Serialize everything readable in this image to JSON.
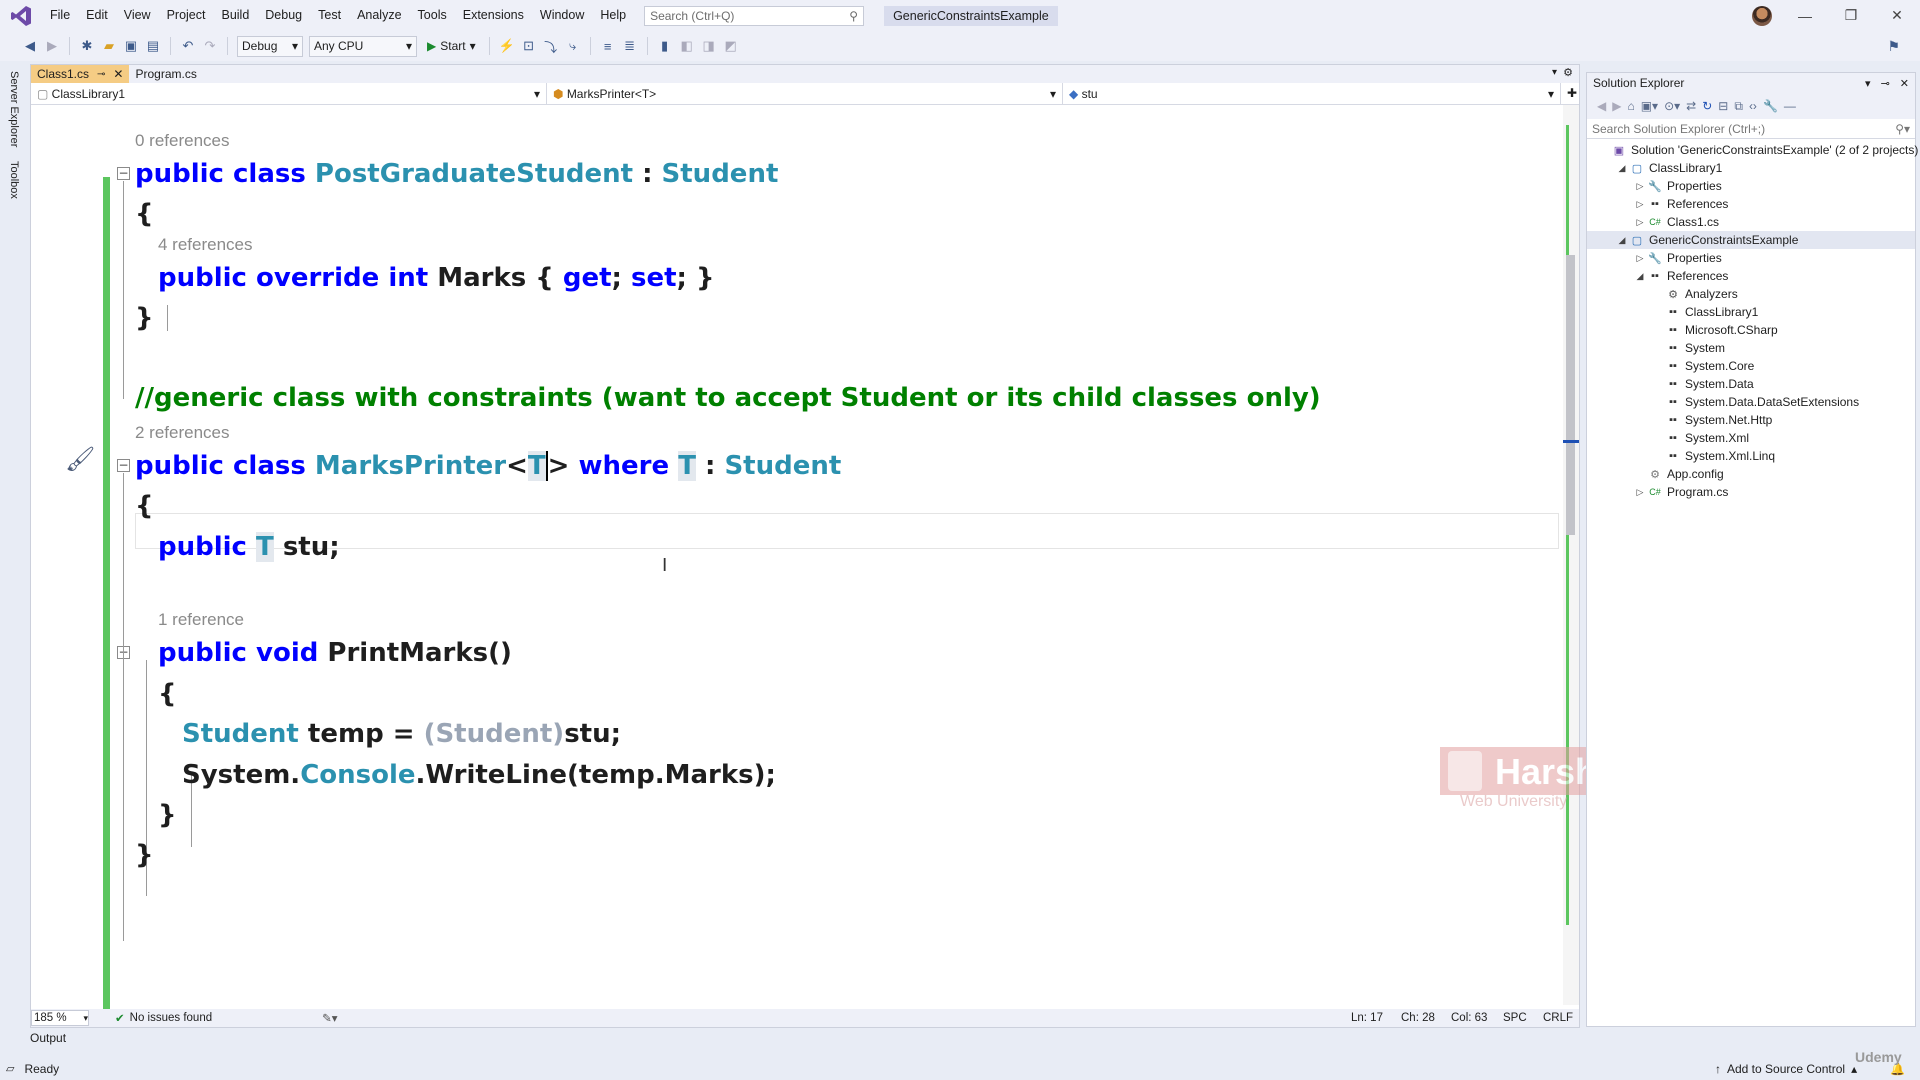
{
  "menu": {
    "items": [
      "File",
      "Edit",
      "View",
      "Project",
      "Build",
      "Debug",
      "Test",
      "Analyze",
      "Tools",
      "Extensions",
      "Window",
      "Help"
    ],
    "search_placeholder": "Search (Ctrl+Q)",
    "solution_name": "GenericConstraintsExample"
  },
  "toolbar": {
    "config": "Debug",
    "platform": "Any CPU",
    "start_label": "Start"
  },
  "side_tabs": [
    "Server Explorer",
    "Toolbox"
  ],
  "editor": {
    "tabs": [
      {
        "label": "Class1.cs",
        "active": true
      },
      {
        "label": "Program.cs",
        "active": false
      }
    ],
    "nav": {
      "project": "ClassLibrary1",
      "type": "MarksPrinter<T>",
      "member": "stu"
    },
    "code": {
      "ref0": "0 references",
      "l1_kw": "public class ",
      "l1_type": "PostGraduateStudent",
      "l1_colon": " : ",
      "l1_base": "Student",
      "brace_open": "{",
      "brace_close": "}",
      "ref1": "4 references",
      "l2_kw": "public override int ",
      "l2_name": "Marks { ",
      "l2_get": "get",
      "l2_semi1": "; ",
      "l2_set": "set",
      "l2_end": "; }",
      "comment": "//generic class with constraints (want to accept Student or its child classes only)",
      "ref2": "2 references",
      "l3_kw": "public class ",
      "l3_type": "MarksPrinter",
      "l3_lt": "<",
      "l3_T": "T",
      "l3_gt": ">",
      "l3_where": " where ",
      "l3_T2": "T",
      "l3_colon": " : ",
      "l3_base": "Student",
      "l4_kw": "public ",
      "l4_T": "T",
      "l4_rest": " stu;",
      "ref3": "1 reference",
      "l5_kw": "public void ",
      "l5_rest": "PrintMarks()",
      "l6_type": "Student",
      "l6_mid": " temp = ",
      "l6_cast": "(Student)",
      "l6_end": "stu;",
      "l7_a": "System.",
      "l7_b": "Console",
      "l7_c": ".WriteLine(temp.Marks);"
    },
    "status": {
      "zoom": "185 %",
      "issues": "No issues found",
      "ln": "Ln: 17",
      "ch": "Ch: 28",
      "col": "Col: 63",
      "spc": "SPC",
      "crlf": "CRLF"
    }
  },
  "watermark": {
    "line1": "Harsha",
    "line2": "Web University"
  },
  "solution_explorer": {
    "title": "Solution Explorer",
    "search_placeholder": "Search Solution Explorer (Ctrl+;)",
    "tree": [
      {
        "label": "Solution 'GenericConstraintsExample' (2 of 2 projects)",
        "icon": "solution-icon",
        "level": 0,
        "toggle": ""
      },
      {
        "label": "ClassLibrary1",
        "icon": "csproj-icon",
        "level": 1,
        "toggle": "expanded"
      },
      {
        "label": "Properties",
        "icon": "wrench-icon",
        "level": 2,
        "toggle": "collapsed"
      },
      {
        "label": "References",
        "icon": "references-icon",
        "level": 2,
        "toggle": "collapsed"
      },
      {
        "label": "Class1.cs",
        "icon": "csharp-file-icon",
        "level": 2,
        "toggle": "collapsed"
      },
      {
        "label": "GenericConstraintsExample",
        "icon": "csproj-icon",
        "level": 1,
        "toggle": "expanded",
        "selected": true
      },
      {
        "label": "Properties",
        "icon": "wrench-icon",
        "level": 2,
        "toggle": "collapsed"
      },
      {
        "label": "References",
        "icon": "references-icon",
        "level": 2,
        "toggle": "expanded"
      },
      {
        "label": "Analyzers",
        "icon": "analyzer-icon",
        "level": 3,
        "toggle": ""
      },
      {
        "label": "ClassLibrary1",
        "icon": "reference-icon",
        "level": 3,
        "toggle": ""
      },
      {
        "label": "Microsoft.CSharp",
        "icon": "reference-icon",
        "level": 3,
        "toggle": ""
      },
      {
        "label": "System",
        "icon": "reference-icon",
        "level": 3,
        "toggle": ""
      },
      {
        "label": "System.Core",
        "icon": "reference-icon",
        "level": 3,
        "toggle": ""
      },
      {
        "label": "System.Data",
        "icon": "reference-icon",
        "level": 3,
        "toggle": ""
      },
      {
        "label": "System.Data.DataSetExtensions",
        "icon": "reference-icon",
        "level": 3,
        "toggle": ""
      },
      {
        "label": "System.Net.Http",
        "icon": "reference-icon",
        "level": 3,
        "toggle": ""
      },
      {
        "label": "System.Xml",
        "icon": "reference-icon",
        "level": 3,
        "toggle": ""
      },
      {
        "label": "System.Xml.Linq",
        "icon": "reference-icon",
        "level": 3,
        "toggle": ""
      },
      {
        "label": "App.config",
        "icon": "config-file-icon",
        "level": 2,
        "toggle": ""
      },
      {
        "label": "Program.cs",
        "icon": "csharp-file-icon",
        "level": 2,
        "toggle": "collapsed"
      }
    ]
  },
  "bottom": {
    "output_tab": "Output",
    "status": "Ready",
    "source_control": "Add to Source Control",
    "brand": "Udemy"
  },
  "colors": {
    "keyword": "#0000ff",
    "type": "#2b91af",
    "comment": "#008000",
    "change_bar": "#5cc65f",
    "active_tab": "#f5cc84"
  }
}
